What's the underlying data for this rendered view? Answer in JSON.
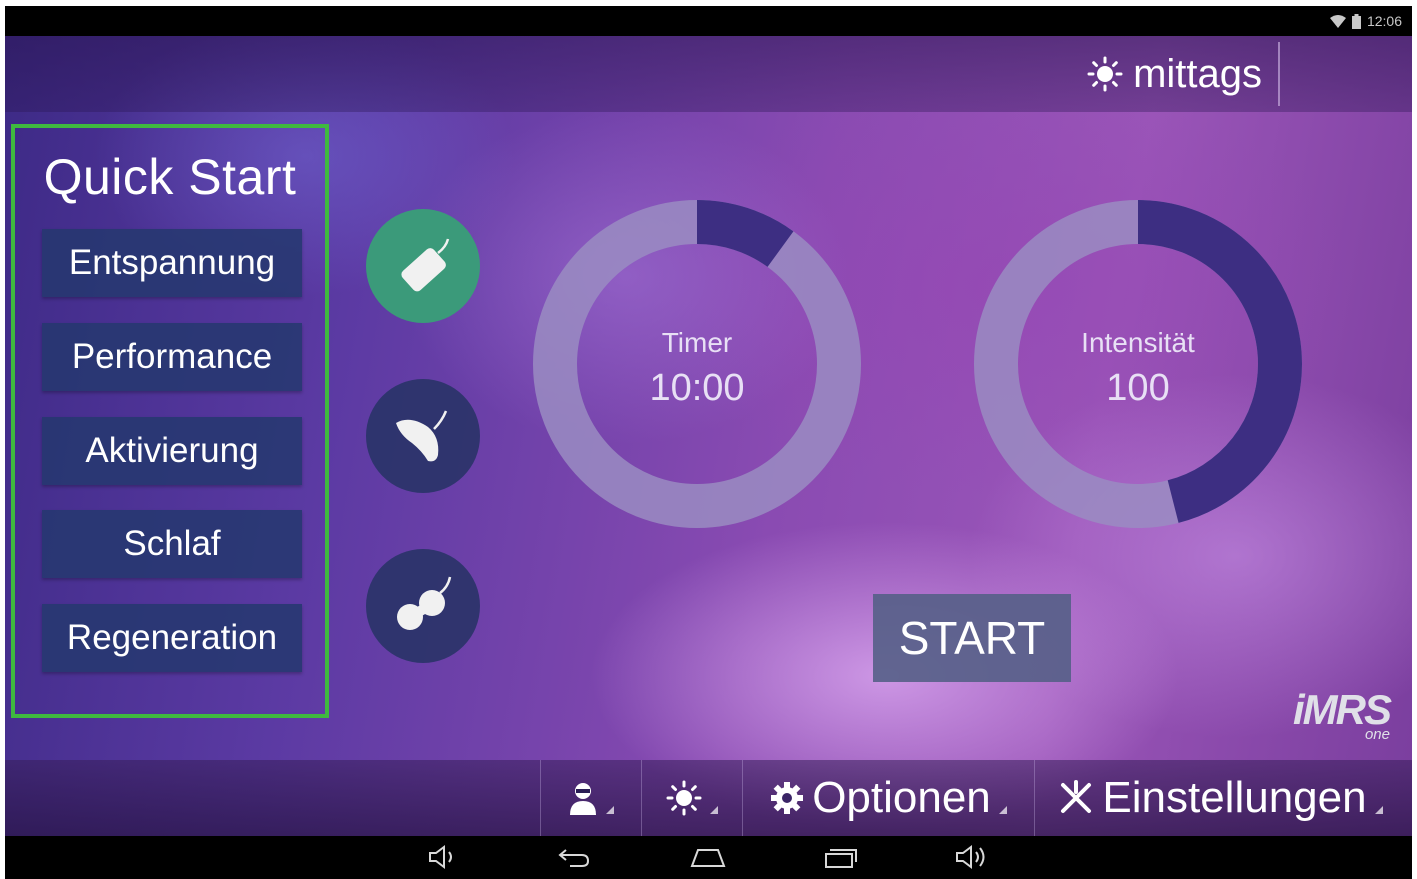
{
  "status_bar": {
    "time": "12:06"
  },
  "header": {
    "time_of_day": "mittags"
  },
  "quick_start": {
    "title": "Quick Start",
    "items": [
      "Entspannung",
      "Performance",
      "Aktivierung",
      "Schlaf",
      "Regeneration"
    ]
  },
  "applicators": [
    "applicator-pad-icon",
    "applicator-spot-icon",
    "applicator-dual-icon"
  ],
  "dials": {
    "timer": {
      "label": "Timer",
      "value": "10:00",
      "fill_fraction": 0.1
    },
    "intensity": {
      "label": "Intensität",
      "value": "100",
      "fill_fraction": 0.46
    }
  },
  "start_button": "START",
  "brand": {
    "logo": "iMRS",
    "sub": "one"
  },
  "bottom_bar": {
    "options": "Optionen",
    "settings": "Einstellungen"
  },
  "colors": {
    "accent_green": "#3fb93f",
    "button_bg": "#263870",
    "active_applicator": "#3b9a7a",
    "dial_track": "#9a8cc2",
    "dial_fill": "#3d2e82"
  }
}
